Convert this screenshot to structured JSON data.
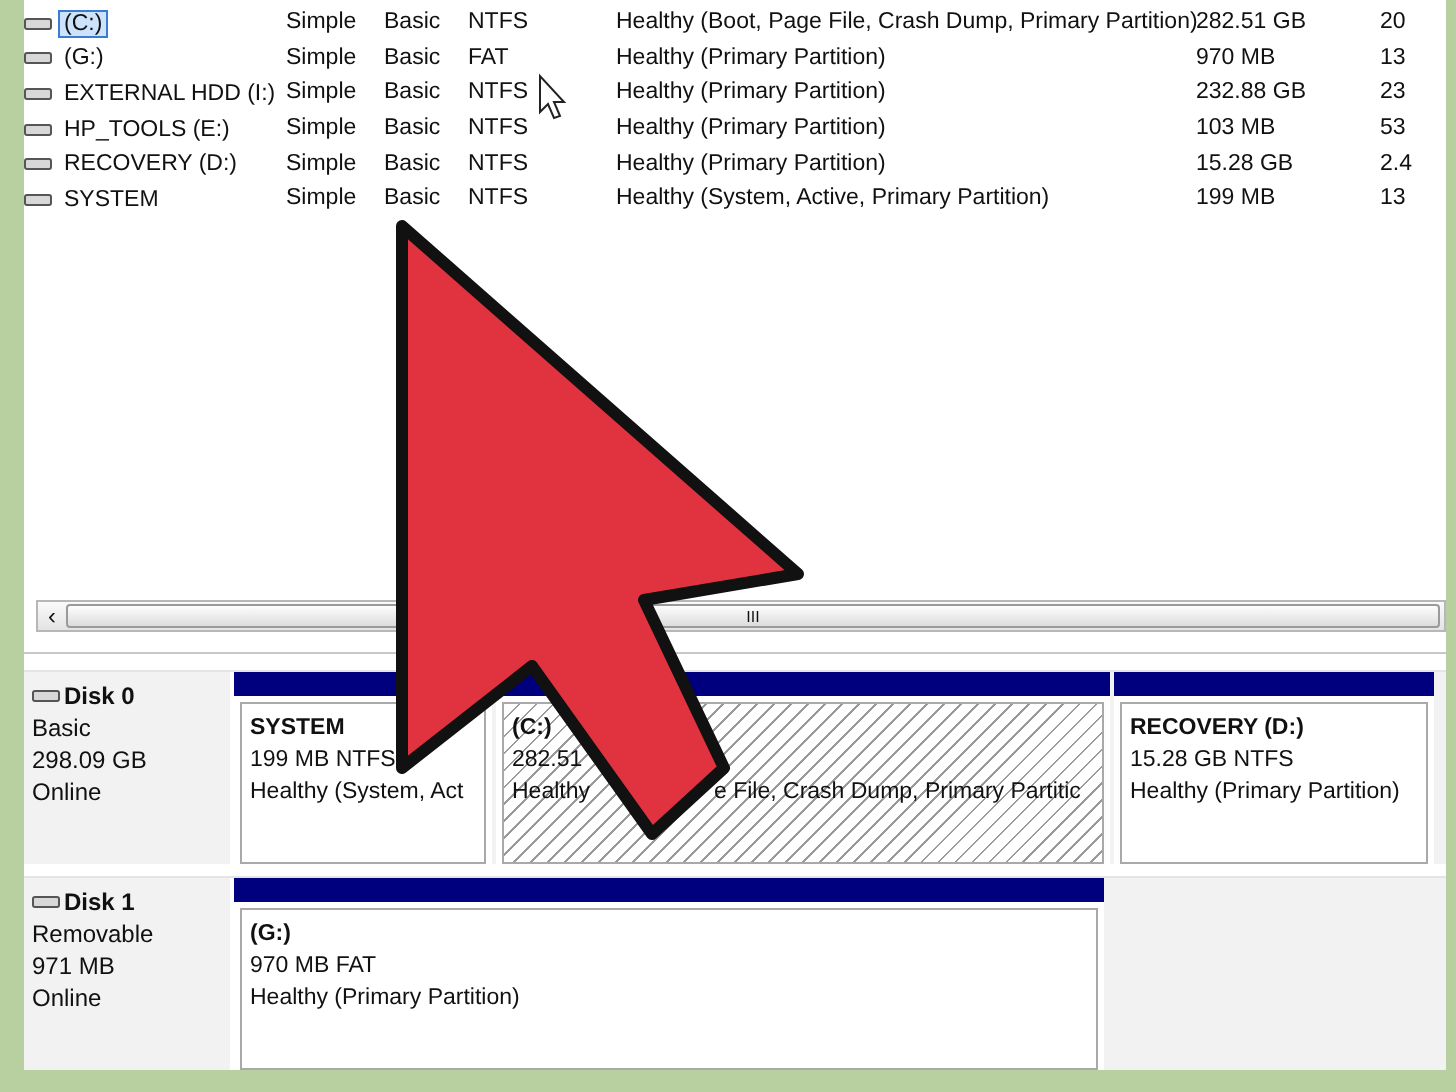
{
  "volumes": [
    {
      "name": "(C:)",
      "selected": true,
      "layout": "Simple",
      "type": "Basic",
      "fs": "NTFS",
      "status": "Healthy (Boot, Page File, Crash Dump, Primary Partition)",
      "capacity": "282.51 GB",
      "free": "20"
    },
    {
      "name": "(G:)",
      "selected": false,
      "layout": "Simple",
      "type": "Basic",
      "fs": "FAT",
      "status": "Healthy (Primary Partition)",
      "capacity": "970 MB",
      "free": "13"
    },
    {
      "name": "EXTERNAL HDD (I:)",
      "selected": false,
      "layout": "Simple",
      "type": "Basic",
      "fs": "NTFS",
      "status": "Healthy (Primary Partition)",
      "capacity": "232.88 GB",
      "free": "23"
    },
    {
      "name": "HP_TOOLS (E:)",
      "selected": false,
      "layout": "Simple",
      "type": "Basic",
      "fs": "NTFS",
      "status": "Healthy (Primary Partition)",
      "capacity": "103 MB",
      "free": "53"
    },
    {
      "name": "RECOVERY (D:)",
      "selected": false,
      "layout": "Simple",
      "type": "Basic",
      "fs": "NTFS",
      "status": "Healthy (Primary Partition)",
      "capacity": "15.28 GB",
      "free": "2.4"
    },
    {
      "name": "SYSTEM",
      "selected": false,
      "layout": "Simple",
      "type": "Basic",
      "fs": "NTFS",
      "status": "Healthy (System, Active, Primary Partition)",
      "capacity": "199 MB",
      "free": "13"
    }
  ],
  "scrollbar": {
    "left_arrow": "‹",
    "grip": "III"
  },
  "disks": [
    {
      "name": "Disk 0",
      "kind": "Basic",
      "size": "298.09 GB",
      "state": "Online",
      "partitions": [
        {
          "title": "SYSTEM",
          "size": "199 MB NTFS",
          "status": "Healthy (System, Act",
          "hatched": false
        },
        {
          "title": "(C:)",
          "size": "282.51",
          "status": "Healthy",
          "status_rest": "e File, Crash Dump, Primary Partitic",
          "hatched": true
        },
        {
          "title": "RECOVERY  (D:)",
          "size": "15.28 GB NTFS",
          "status": "Healthy (Primary Partition)",
          "hatched": false
        }
      ]
    },
    {
      "name": "Disk 1",
      "kind": "Removable",
      "size": "971 MB",
      "state": "Online",
      "partitions": [
        {
          "title": "(G:)",
          "size": "970 MB FAT",
          "status": "Healthy (Primary Partition)",
          "hatched": false
        }
      ]
    }
  ]
}
